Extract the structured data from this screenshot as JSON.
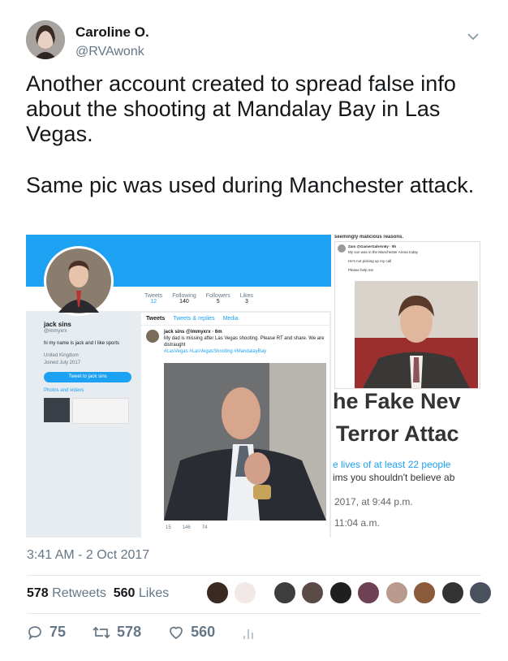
{
  "author": {
    "name": "Caroline O.",
    "handle": "@RVAwonk"
  },
  "tweet": {
    "paragraph1": "Another account created to spread false info about the shooting at Mandalay Bay in Las Vegas.",
    "paragraph2": "Same pic was used during Manchester attack."
  },
  "embedded": {
    "left": {
      "profile_name": "jack sins",
      "profile_handle": "@immyxrx",
      "bio": "hi my name is jack and I like sports",
      "location": "United Kingdom",
      "joined": "Joined July 2017",
      "tweet_to_button": "Tweet to jack sins",
      "photos_label": "Photos and videos",
      "stats": [
        {
          "label": "Tweets",
          "value": "12"
        },
        {
          "label": "Following",
          "value": "140"
        },
        {
          "label": "Followers",
          "value": "5"
        },
        {
          "label": "Likes",
          "value": "3"
        }
      ],
      "tabs": [
        "Tweets",
        "Tweets & replies",
        "Media"
      ],
      "tweet_header": "jack sins @immyxrx · 6m",
      "tweet_body": "My dad is missing after Las Vegas shooting. Please RT and share. We are distraught",
      "tweet_tags": "#LasVegas #LasVegasShooting #MandalayBay",
      "tweet_counts": {
        "replies": "15",
        "retweets": "146",
        "likes": "74"
      }
    },
    "right": {
      "top_caption": "seemingly malicious reasons.",
      "reply_header": "Zam @GamerGaleAn6y · 9h",
      "reply_line1": "My son was in the Manchester Arena today",
      "reply_line2": "He's not picking up my call",
      "reply_line3": "Please help me",
      "headline1": "he Fake Nev",
      "headline2": "Terror Attac",
      "sub1": "e lives of at least 22 people",
      "sub2": "ims you shouldn't believe ab",
      "date1": "2017, at 9:44 p.m.",
      "date2": "11:04 a.m."
    }
  },
  "timestamp": "3:41 AM - 2 Oct 2017",
  "engagement": {
    "retweets_count": "578",
    "retweets_label": "Retweets",
    "likes_count": "560",
    "likes_label": "Likes"
  },
  "actions": {
    "reply_count": "75",
    "retweet_count": "578",
    "like_count": "560"
  },
  "colors": {
    "twitter_blue": "#1da1f2",
    "secondary_text": "#657786"
  }
}
